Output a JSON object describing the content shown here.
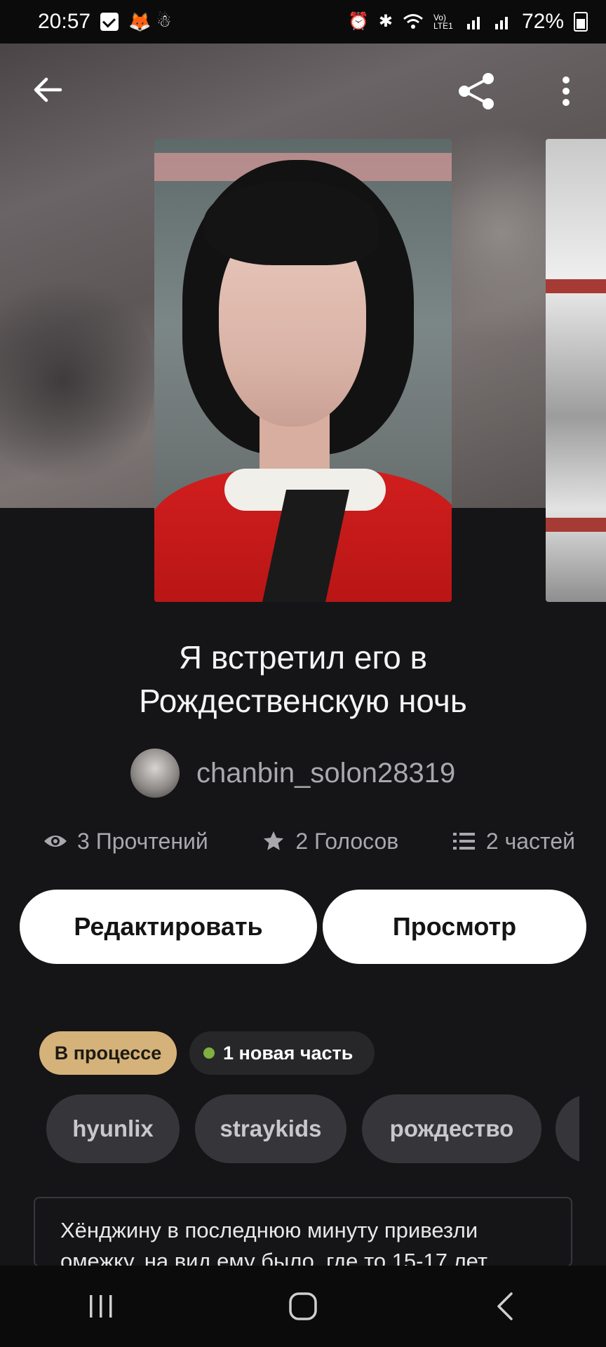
{
  "status_bar": {
    "time": "20:57",
    "battery": "72%",
    "network": "Vo) LTE1"
  },
  "header": {
    "back_icon": "arrow-left-icon",
    "share_icon": "share-icon",
    "more_icon": "more-vertical-icon"
  },
  "story": {
    "title_line1": "Я встретил его в",
    "title_line2": "Рождественскую ночь",
    "author": "chanbin_solon28319"
  },
  "stats": {
    "reads": "3 Прочтений",
    "votes": "2 Голосов",
    "parts": "2 частей"
  },
  "actions": {
    "edit_label": "Редактировать",
    "view_label": "Просмотр"
  },
  "status_chips": {
    "progress": "В процессе",
    "new_part": "1 новая часть"
  },
  "tags": [
    "hyunlix",
    "straykids",
    "рождество"
  ],
  "description": "Хёнджину в последнюю минуту привезли омежку, на вид ему было, где то 15-17 лет",
  "colors": {
    "background": "#151417",
    "progress_chip": "#d5b27a",
    "new_dot": "#7fb040",
    "tag_bg": "#36363a"
  }
}
